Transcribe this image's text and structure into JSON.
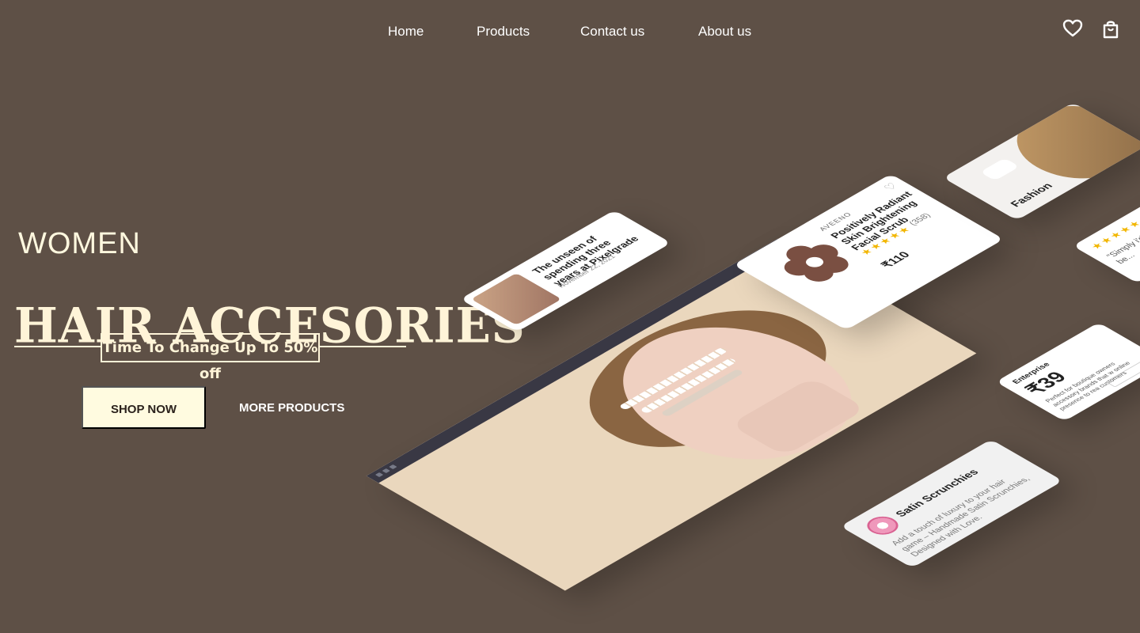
{
  "nav": {
    "links": [
      "Home",
      "Products",
      "Contact us",
      "About us"
    ],
    "icons": {
      "wishlist": "heart-icon",
      "cart": "bag-icon"
    }
  },
  "hero": {
    "kicker": "WOMEN",
    "title": "HAIR ACCESORIES",
    "offer": "Time To Change Up To 50% off",
    "primary_cta": "SHOP NOW",
    "secondary_cta": "MORE PRODUCTS"
  },
  "collage": {
    "blog": {
      "title": "The unseen of spending three years at Pixelgrade",
      "date": "November 22, 2021"
    },
    "product": {
      "brand": "AVEENO",
      "name": "Positively Radiant Skin Brightening Facial Scrub",
      "rating": 5,
      "reviews": "(358)",
      "price": "₹110"
    },
    "fashion": {
      "label": "Fashion"
    },
    "review": {
      "text": "\"Simply i'd reco be..."
    },
    "pricing": {
      "plan": "Enterprise",
      "price": "₹39",
      "description": "Perfect for boutique owners accessory brands that w online presence to rea customers"
    },
    "scrunchies": {
      "title": "Satin Scrunchies",
      "description": "Add a touch of luxury to your hair game – Handmade Satin Scrunchies, Designed with Love."
    }
  },
  "colors": {
    "background": "#5e5046",
    "cream": "#fff4d8",
    "button": "#fffbe0",
    "rating": "#f2b600"
  }
}
